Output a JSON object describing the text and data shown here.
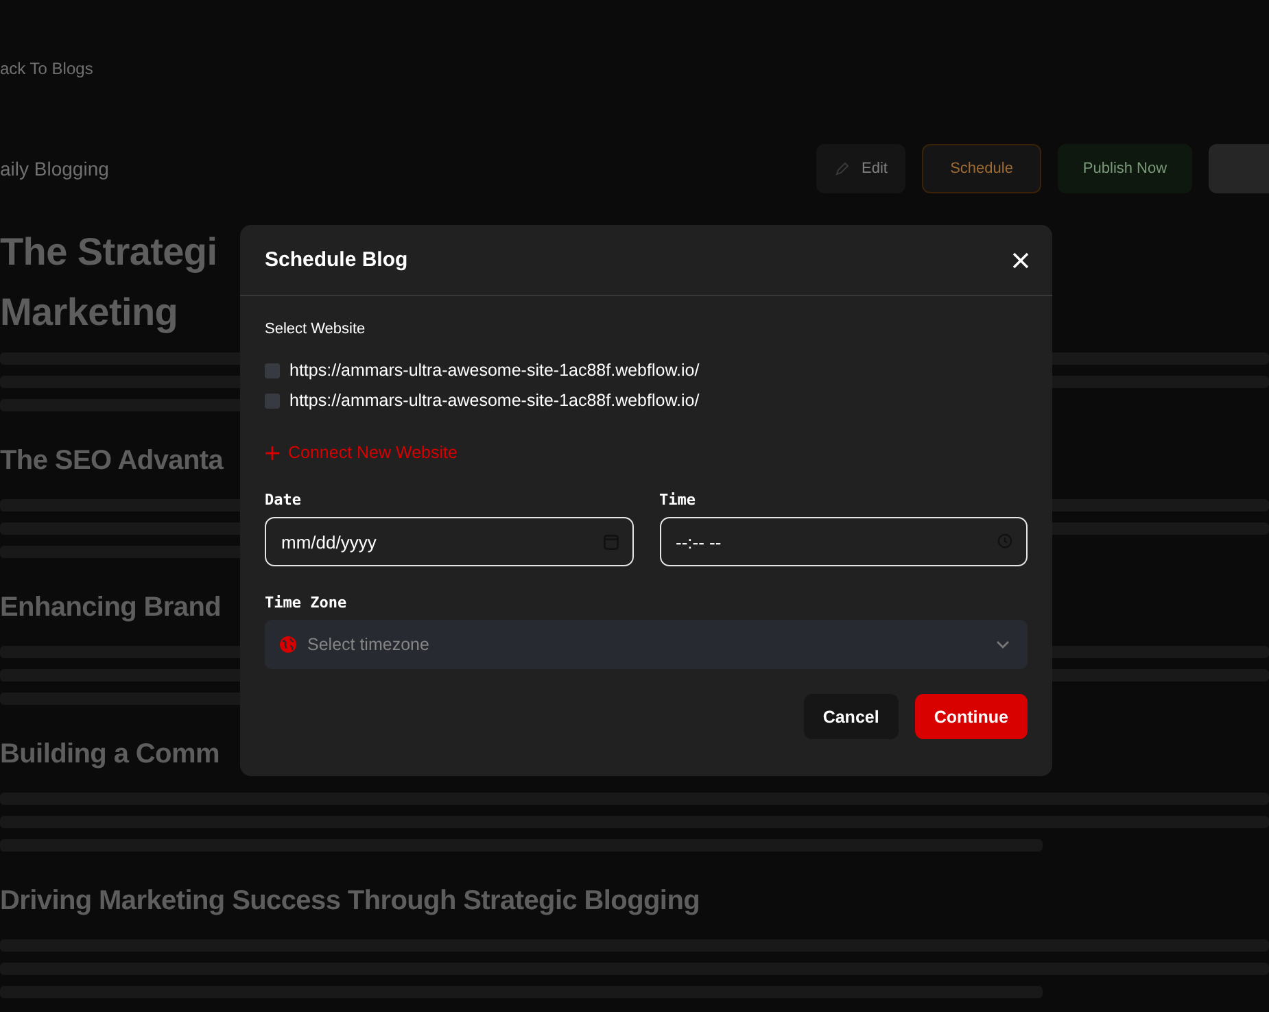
{
  "page": {
    "back_link": "ack To Blogs",
    "title": "aily Blogging",
    "actions": [
      {
        "kind": "edit",
        "label": "Edit"
      },
      {
        "kind": "schedule",
        "label": "Schedule"
      },
      {
        "kind": "publish",
        "label": "Publish Now"
      },
      {
        "kind": "more"
      }
    ],
    "sections": [
      {
        "kind": "title",
        "heading": [
          "The Strategi",
          "Marketing"
        ]
      },
      {
        "kind": "section",
        "heading": [
          "The SEO Advanta"
        ]
      },
      {
        "kind": "section",
        "heading": [
          "Enhancing Brand"
        ]
      },
      {
        "kind": "section",
        "heading": [
          "Building a Comm"
        ]
      },
      {
        "kind": "section",
        "heading": [
          "Driving Marketing Success Through Strategic Blogging"
        ]
      }
    ]
  },
  "modal": {
    "title": "Schedule Blog",
    "website_label": "Select Website",
    "websites": [
      {
        "url": "https://ammars-ultra-awesome-site-1ac88f.webflow.io/",
        "checked": false
      },
      {
        "url": "https://ammars-ultra-awesome-site-1ac88f.webflow.io/",
        "checked": false
      }
    ],
    "connect_link": "Connect New Website",
    "date": {
      "label": "Date",
      "placeholder": "mm/dd/yyyy"
    },
    "time": {
      "label": "Time",
      "placeholder": "--:-- --"
    },
    "timezone": {
      "label": "Time Zone",
      "placeholder": "Select timezone"
    },
    "buttons": [
      {
        "kind": "cancel",
        "label": "Cancel"
      },
      {
        "kind": "primary",
        "label": "Continue"
      }
    ]
  }
}
